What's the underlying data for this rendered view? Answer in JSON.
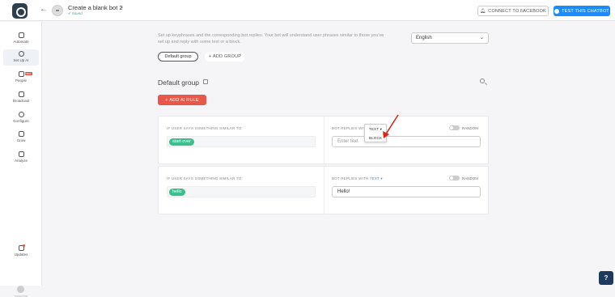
{
  "header": {
    "bot_title": "Create a blank bot 2",
    "saved_label": "Saved",
    "connect_label": "CONNECT TO FACEBOOK",
    "test_label": "TEST THIS CHATBOT"
  },
  "sidebar": {
    "items": [
      {
        "label": "Automate",
        "icon": "automate-icon"
      },
      {
        "label": "Set Up AI",
        "icon": "ai-icon",
        "active": true
      },
      {
        "label": "People",
        "icon": "people-icon",
        "badge": "NEW"
      },
      {
        "label": "Broadcast",
        "icon": "broadcast-icon"
      },
      {
        "label": "Configure",
        "icon": "gear-icon"
      },
      {
        "label": "Grow",
        "icon": "grow-icon"
      },
      {
        "label": "Analyze",
        "icon": "chart-icon"
      }
    ],
    "updates_label": "Updates"
  },
  "main": {
    "description": "Set up keyphrases and the corresponding bot replies. Your bot will understand user phrases similar to those you've set up and reply with some text or a block.",
    "language": "English",
    "group_chip": "Default group",
    "add_group": "ADD GROUP",
    "group_title": "Default group",
    "add_rule": "ADD AI RULE",
    "rules": [
      {
        "if_label": "IF USER SAYS SOMETHING SIMILAR TO:",
        "phrase": "start over",
        "bot_replies_label": "BOT REPLIES WITH",
        "reply_type": "TEXT",
        "random_label": "RANDOM",
        "reply_placeholder": "Enter text",
        "reply_value": ""
      },
      {
        "if_label": "IF USER SAYS SOMETHING SIMILAR TO:",
        "phrase": "hello",
        "bot_replies_label": "BOT REPLIES WITH",
        "reply_type": "TEXT",
        "random_label": "RANDOM",
        "reply_placeholder": "",
        "reply_value": "Hello!"
      }
    ],
    "dropdown": {
      "options": [
        "TEXT",
        "BLOCK"
      ]
    }
  },
  "colors": {
    "accent_blue": "#1a8cff",
    "add_rule_red": "#e8574a",
    "chip_green": "#3cbf8f",
    "arrow_red": "#d9261c"
  }
}
